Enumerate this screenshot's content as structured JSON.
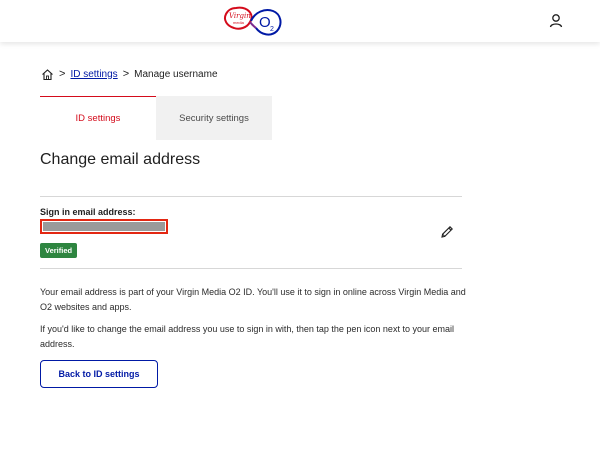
{
  "header": {
    "logo_virgin": "Virgin",
    "logo_media": "media",
    "logo_o2": "O",
    "logo_o2_sub": "2",
    "user_icon": "user-icon"
  },
  "breadcrumb": {
    "home_icon": "home-icon",
    "separator": ">",
    "link": "ID settings",
    "current": "Manage username"
  },
  "tabs": [
    {
      "label": "ID settings",
      "active": true
    },
    {
      "label": "Security settings",
      "active": false
    }
  ],
  "page": {
    "title": "Change email address",
    "email_label": "Sign in email address:",
    "verified_badge": "Verified",
    "edit_icon": "pencil-icon",
    "paragraph_1": "Your email address is part of your Virgin Media O2 ID. You'll use it to sign in online across Virgin Media and O2 websites and apps.",
    "paragraph_2": "If you'd like to change the email address you use to sign in with, then tap the pen icon next to your email address.",
    "back_button": "Back to ID settings"
  },
  "colors": {
    "brand_red": "#d40b1b",
    "link_blue": "#0019a5",
    "verified_green": "#2e8540",
    "redaction_border": "#e32712"
  }
}
